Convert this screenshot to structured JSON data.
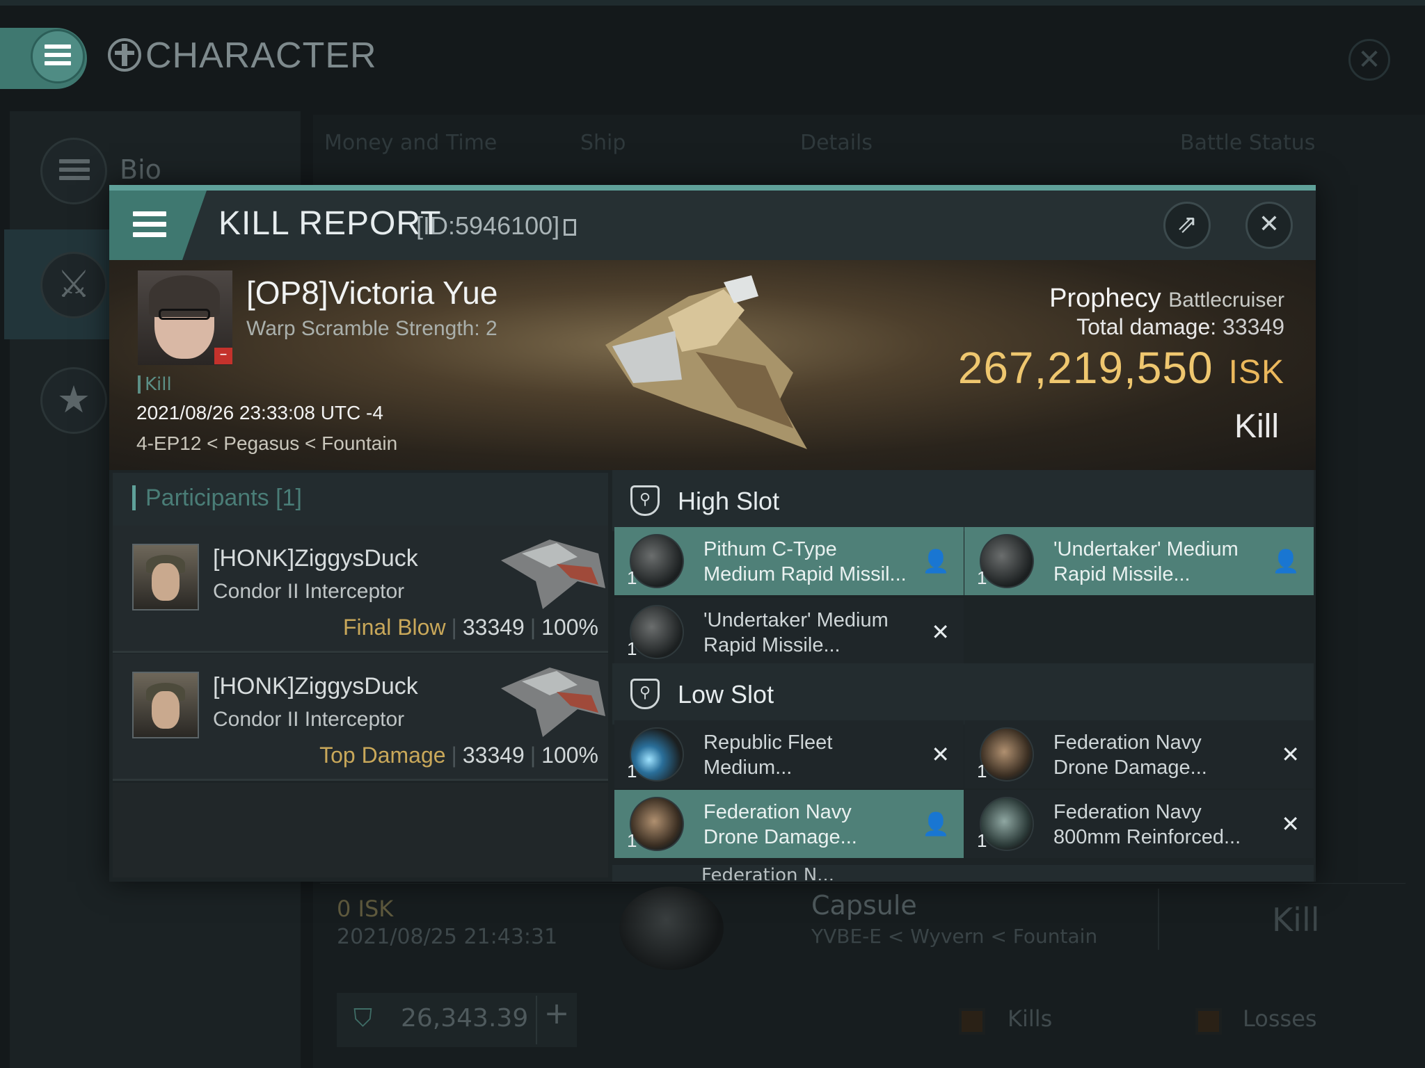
{
  "app": {
    "title": "CHARACTER",
    "sidebar": {
      "bio_label": "Bio"
    },
    "tabs": [
      "Money and Time",
      "Ship",
      "Details",
      "Battle Status"
    ],
    "background_row": {
      "isk": "0  ISK",
      "date": "2021/08/25  21:43:31",
      "ship": "Capsule",
      "location": "YVBE-E < Wyvern < Fountain",
      "result": "Kill"
    },
    "wallet": {
      "value": "26,343.39"
    },
    "legend": {
      "kills": "Kills",
      "losses": "Losses"
    }
  },
  "kill_report": {
    "title": "KILL REPORT",
    "id": "[ID:5946100]",
    "victim": {
      "name": "[OP8]Victoria Yue",
      "scram": "Warp Scramble Strength: 2",
      "tag": "Kill",
      "time": "2021/08/26 23:33:08 UTC -4",
      "location": "4-EP12 < Pegasus < Fountain"
    },
    "ship": {
      "name": "Prophecy",
      "class": "Battlecruiser",
      "total_damage_label": "Total damage:",
      "total_damage": "33349",
      "isk_value": "267,219,550",
      "isk_unit": "ISK",
      "result": "Kill"
    },
    "participants": {
      "title": "Participants [1]",
      "rows": [
        {
          "name": "[HONK]ZiggysDuck",
          "ship": "Condor II Interceptor",
          "role": "Final Blow",
          "damage": "33349",
          "percent": "100%"
        },
        {
          "name": "[HONK]ZiggysDuck",
          "ship": "Condor II Interceptor",
          "role": "Top Damage",
          "damage": "33349",
          "percent": "100%"
        }
      ]
    },
    "high_slot": {
      "title": "High Slot",
      "items": [
        {
          "name_1": "Pithum C-Type",
          "name_2": "Medium Rapid Missil...",
          "qty": "1",
          "status": "dropped"
        },
        {
          "name_1": "'Undertaker' Medium",
          "name_2": "Rapid Missile...",
          "qty": "1",
          "status": "dropped"
        },
        {
          "name_1": "'Undertaker' Medium",
          "name_2": "Rapid Missile...",
          "qty": "1",
          "status": "destroyed"
        }
      ]
    },
    "low_slot": {
      "title": "Low Slot",
      "items": [
        {
          "name_1": "Republic Fleet",
          "name_2": "Medium...",
          "qty": "1",
          "status": "destroyed"
        },
        {
          "name_1": "Federation Navy",
          "name_2": "Drone Damage...",
          "qty": "1",
          "status": "destroyed"
        },
        {
          "name_1": "Federation Navy",
          "name_2": "Drone Damage...",
          "qty": "1",
          "status": "dropped"
        },
        {
          "name_1": "Federation Navy",
          "name_2": "800mm Reinforced...",
          "qty": "1",
          "status": "destroyed"
        }
      ],
      "cutoff": "Federation N..."
    }
  }
}
